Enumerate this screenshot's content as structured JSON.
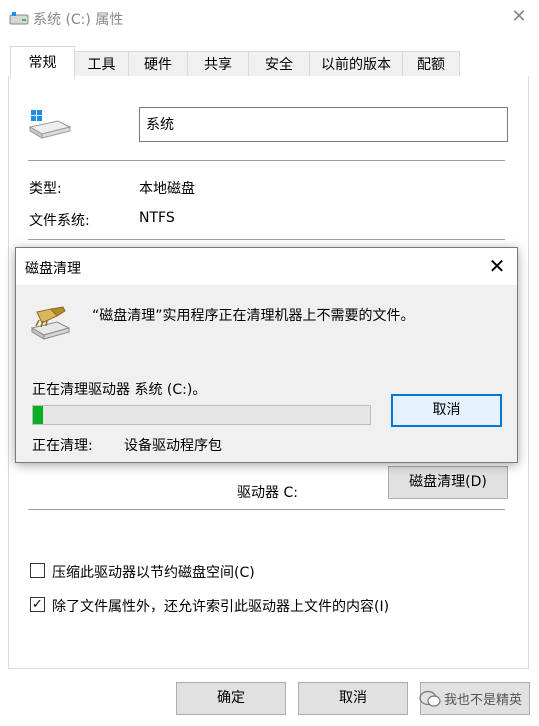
{
  "window": {
    "title": "系统 (C:) 属性",
    "close_icon": "close-icon"
  },
  "tabs": [
    {
      "label": "常规",
      "active": true
    },
    {
      "label": "工具",
      "active": false
    },
    {
      "label": "硬件",
      "active": false
    },
    {
      "label": "共享",
      "active": false
    },
    {
      "label": "安全",
      "active": false
    },
    {
      "label": "以前的版本",
      "active": false
    },
    {
      "label": "配额",
      "active": false
    }
  ],
  "general": {
    "drive_icon": "drive-icon",
    "name_value": "系统",
    "type_label": "类型:",
    "type_value": "本地磁盘",
    "fs_label": "文件系统:",
    "fs_value": "NTFS",
    "drive_label": "驱动器 C:",
    "cleanup_button": "磁盘清理(D)",
    "compress_label": "压缩此驱动器以节约磁盘空间(C)",
    "compress_checked": false,
    "index_label": "除了文件属性外，还允许索引此驱动器上文件的内容(I)",
    "index_checked": true
  },
  "dialog": {
    "title": "磁盘清理",
    "message": "“磁盘清理”实用程序正在清理机器上不需要的文件。",
    "status": "正在清理驱动器 系统 (C:)。",
    "progress": 0.01,
    "cancel_button": "取消",
    "current_label": "正在清理:",
    "current_value": "设备驱动程序包"
  },
  "footer": {
    "ok_button": "确定",
    "cancel_button": "取消"
  },
  "watermark": {
    "text": "我也不是精英"
  },
  "colors": {
    "accent": "#0078d7",
    "progress_fill": "#06b025"
  }
}
